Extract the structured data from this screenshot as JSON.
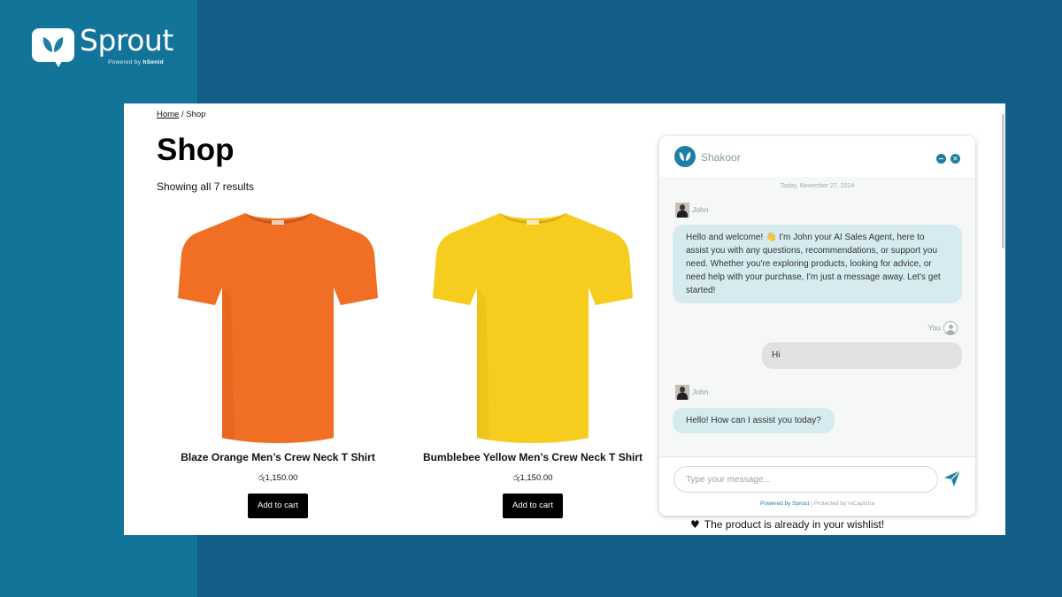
{
  "brand": {
    "name": "Sprout",
    "powered_prefix": "Powered by ",
    "powered_by": "hSenid",
    "logo_icon": "leaf-chat-bubble-icon"
  },
  "colors": {
    "background": "#135f87",
    "left_panel": "#13749a",
    "accent": "#1f7ea3",
    "bot_bubble": "#d6ebef",
    "user_bubble": "#e1e1e1",
    "orange_shirt": "#f06f24",
    "yellow_shirt": "#f6cd1f"
  },
  "shop": {
    "breadcrumb_home": "Home",
    "breadcrumb_sep": " / ",
    "breadcrumb_current": "Shop",
    "title": "Shop",
    "result_count": "Showing all 7 results",
    "products": [
      {
        "name": "Blaze Orange Men’s Crew Neck T Shirt",
        "price": "රු1,150.00",
        "button": "Add to cart",
        "color": "orange"
      },
      {
        "name": "Bumblebee Yellow Men’s Crew Neck T Shirt",
        "price": "රු1,150.00",
        "button": "Add to cart",
        "color": "yellow"
      }
    ],
    "wishlist_notice": "The product is already in your wishlist!"
  },
  "chat": {
    "agent_name": "Shakoor",
    "date_label": "Today, November 27, 2024",
    "messages": [
      {
        "sender": "John",
        "text": "Hello and welcome! 👋 I'm John your AI Sales Agent, here to assist you with any questions, recommendations, or support you need. Whether you're exploring products, looking for advice, or need help with your purchase, I'm just a message away. Let's get started!"
      },
      {
        "sender": "You",
        "text": "Hi"
      },
      {
        "sender": "John",
        "text": "Hello! How can I assist you today?"
      }
    ],
    "input_placeholder": "Type your message...",
    "powered": "Powered by Sprout",
    "separator": "|",
    "protected": "Protected by reCaptcha"
  }
}
